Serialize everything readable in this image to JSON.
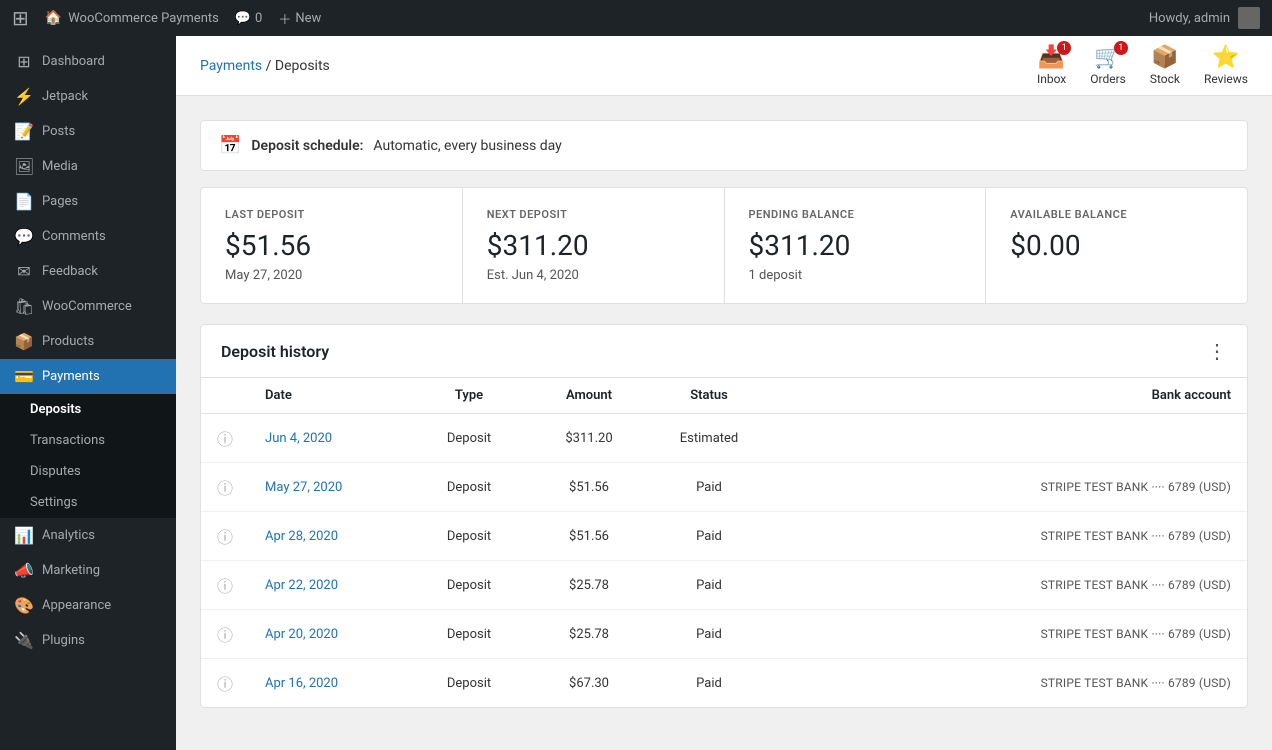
{
  "adminBar": {
    "siteName": "WooCommerce Payments",
    "commentsLabel": "0",
    "newLabel": "New",
    "howdy": "Howdy, admin"
  },
  "sidebar": {
    "items": [
      {
        "id": "dashboard",
        "label": "Dashboard",
        "icon": "⊞"
      },
      {
        "id": "jetpack",
        "label": "Jetpack",
        "icon": "⚡"
      },
      {
        "id": "posts",
        "label": "Posts",
        "icon": "📝"
      },
      {
        "id": "media",
        "label": "Media",
        "icon": "🖼"
      },
      {
        "id": "pages",
        "label": "Pages",
        "icon": "📄"
      },
      {
        "id": "comments",
        "label": "Comments",
        "icon": "💬"
      },
      {
        "id": "feedback",
        "label": "Feedback",
        "icon": "✉"
      },
      {
        "id": "woocommerce",
        "label": "WooCommerce",
        "icon": "🛍"
      },
      {
        "id": "products",
        "label": "Products",
        "icon": "📦"
      },
      {
        "id": "payments",
        "label": "Payments",
        "icon": "💳",
        "active": true
      },
      {
        "id": "analytics",
        "label": "Analytics",
        "icon": "📊"
      },
      {
        "id": "marketing",
        "label": "Marketing",
        "icon": "📣"
      },
      {
        "id": "appearance",
        "label": "Appearance",
        "icon": "🎨"
      },
      {
        "id": "plugins",
        "label": "Plugins",
        "icon": "🔌"
      }
    ],
    "submenu": [
      {
        "id": "deposits",
        "label": "Deposits",
        "active": true
      },
      {
        "id": "transactions",
        "label": "Transactions"
      },
      {
        "id": "disputes",
        "label": "Disputes"
      },
      {
        "id": "settings",
        "label": "Settings"
      }
    ]
  },
  "topBar": {
    "breadcrumb": {
      "parent": "Payments",
      "current": "Deposits"
    },
    "icons": [
      {
        "id": "inbox",
        "label": "Inbox",
        "badge": "1"
      },
      {
        "id": "orders",
        "label": "Orders",
        "badge": "1"
      },
      {
        "id": "stock",
        "label": "Stock",
        "badge": null
      },
      {
        "id": "reviews",
        "label": "Reviews",
        "badge": null
      }
    ]
  },
  "depositSchedule": {
    "prefix": "Deposit schedule:",
    "value": "Automatic, every business day"
  },
  "stats": [
    {
      "id": "last-deposit",
      "label": "LAST DEPOSIT",
      "value": "$51.56",
      "sub": "May 27, 2020"
    },
    {
      "id": "next-deposit",
      "label": "NEXT DEPOSIT",
      "value": "$311.20",
      "sub": "Est. Jun 4, 2020"
    },
    {
      "id": "pending-balance",
      "label": "PENDING BALANCE",
      "value": "$311.20",
      "sub": "1 deposit"
    },
    {
      "id": "available-balance",
      "label": "AVAILABLE BALANCE",
      "value": "$0.00",
      "sub": ""
    }
  ],
  "depositHistory": {
    "title": "Deposit history",
    "columns": [
      "",
      "Date",
      "Type",
      "Amount",
      "Status",
      "Bank account"
    ],
    "rows": [
      {
        "date": "Jun 4, 2020",
        "type": "Deposit",
        "amount": "$311.20",
        "status": "Estimated",
        "bank": ""
      },
      {
        "date": "May 27, 2020",
        "type": "Deposit",
        "amount": "$51.56",
        "status": "Paid",
        "bank": "STRIPE TEST BANK ···· 6789 (USD)"
      },
      {
        "date": "Apr 28, 2020",
        "type": "Deposit",
        "amount": "$51.56",
        "status": "Paid",
        "bank": "STRIPE TEST BANK ···· 6789 (USD)"
      },
      {
        "date": "Apr 22, 2020",
        "type": "Deposit",
        "amount": "$25.78",
        "status": "Paid",
        "bank": "STRIPE TEST BANK ···· 6789 (USD)"
      },
      {
        "date": "Apr 20, 2020",
        "type": "Deposit",
        "amount": "$25.78",
        "status": "Paid",
        "bank": "STRIPE TEST BANK ···· 6789 (USD)"
      },
      {
        "date": "Apr 16, 2020",
        "type": "Deposit",
        "amount": "$67.30",
        "status": "Paid",
        "bank": "STRIPE TEST BANK ···· 6789 (USD)"
      }
    ]
  }
}
